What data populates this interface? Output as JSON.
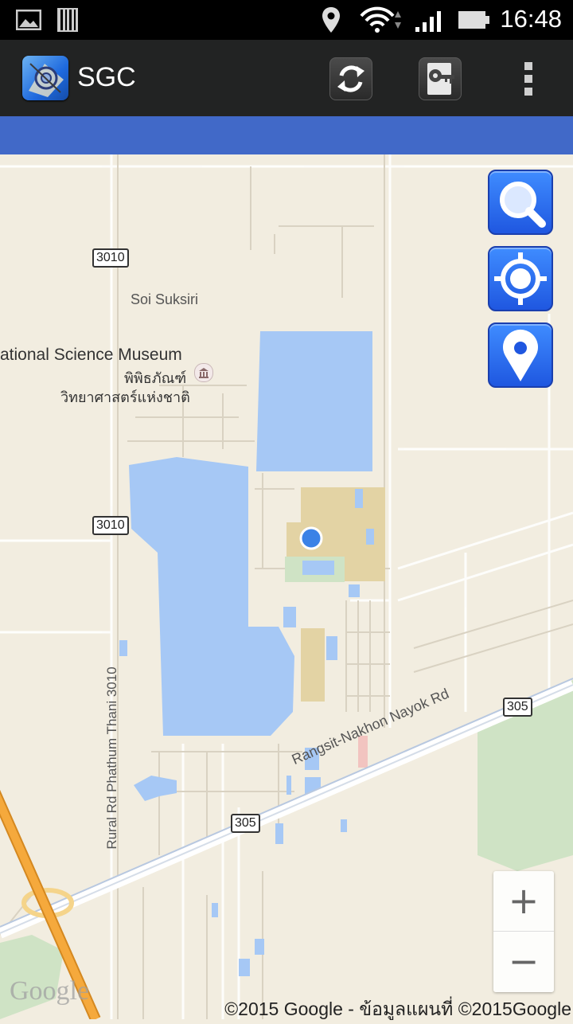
{
  "status_bar": {
    "time": "16:48",
    "icons": [
      "image-notification-icon",
      "barcode-notification-icon",
      "location-icon",
      "wifi-icon",
      "signal-icon",
      "battery-icon"
    ]
  },
  "action_bar": {
    "title": "SGC",
    "actions": [
      "refresh-icon",
      "login-key-icon",
      "overflow-menu-icon"
    ]
  },
  "map": {
    "labels": {
      "soi": "Soi Suksiri",
      "museum_en": "ational Science Museum",
      "museum_th1": "พิพิธภัณฑ์",
      "museum_th2": "วิทยาศาสตร์แห่งชาติ",
      "road_vertical": "Rural Rd Phathum Thani 3010",
      "road_diagonal": "Rangsit-Nakhon Nayok Rd"
    },
    "shields": {
      "top": "3010",
      "middle": "3010",
      "right": "305",
      "bottom": "305"
    },
    "buttons": [
      "search-icon",
      "gps-target-icon",
      "map-pin-icon"
    ],
    "zoom": {
      "in": "+",
      "out": "−"
    },
    "copyright": "©2015 Google - ข้อมูลแผนที่ ©2015Google",
    "logo": "Google",
    "colors": {
      "water": "#a6c8f5",
      "park": "#cfe3c5",
      "campus": "#e3d3a4",
      "highway": "#f2a13a",
      "location_dot": "#3b82e6"
    }
  }
}
